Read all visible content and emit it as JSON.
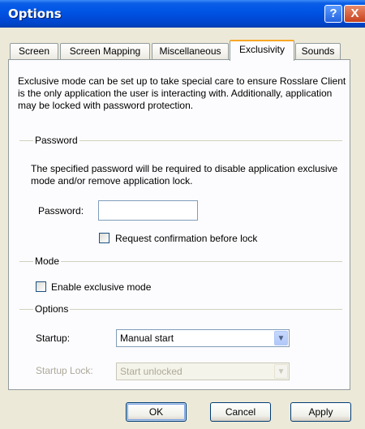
{
  "window": {
    "title": "Options",
    "help_glyph": "?",
    "close_glyph": "X"
  },
  "tabs": [
    {
      "label": "Screen"
    },
    {
      "label": "Screen Mapping"
    },
    {
      "label": "Miscellaneous"
    },
    {
      "label": "Exclusivity",
      "active": true
    },
    {
      "label": "Sounds"
    }
  ],
  "description": "Exclusive mode can be set up to take special care to ensure Rosslare Client is the only application the user is interacting with. Additionally, application may be locked with password protection.",
  "password_group": {
    "label": "Password",
    "description": "The specified password will be required to disable application exclusive mode and/or remove application lock.",
    "password_label": "Password:",
    "password_value": "",
    "confirm_label": "Request confirmation before lock",
    "confirm_checked": false
  },
  "mode_group": {
    "label": "Mode",
    "exclusive_label": "Enable exclusive mode",
    "exclusive_checked": false
  },
  "options_group": {
    "label": "Options",
    "startup_label": "Startup:",
    "startup_value": "Manual start",
    "startup_lock_label": "Startup Lock:",
    "startup_lock_value": "Start unlocked"
  },
  "buttons": {
    "ok": "OK",
    "cancel": "Cancel",
    "apply": "Apply"
  },
  "icons": {
    "dropdown": "chevron-down-icon",
    "help": "help-icon",
    "close": "close-icon"
  },
  "colors": {
    "titlebar": "#0055e5",
    "active_tab_accent": "#f7a726",
    "dialog_bg": "#ece9d8"
  }
}
